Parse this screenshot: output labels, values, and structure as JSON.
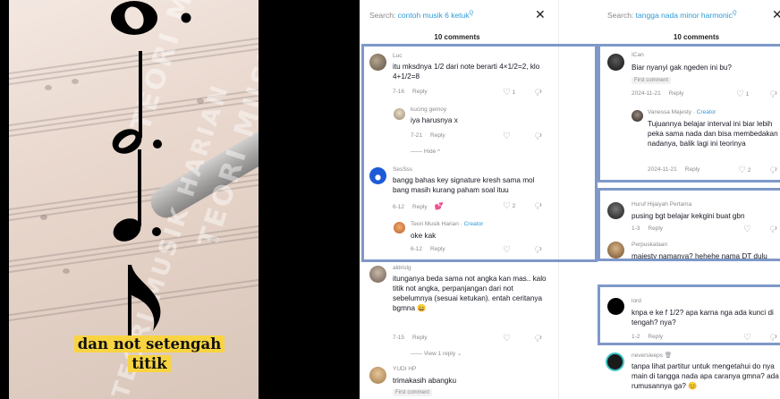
{
  "video": {
    "caption": "dan not setengah titik",
    "watermark_1": "TEORI MUSIK HARIAN",
    "watermark_2": "TEORI MUSIK HARIAN",
    "watermark_3": "TEORI MUSIK HARIAN"
  },
  "panel1": {
    "search_label": "Search:",
    "search_query": "contoh musik 6 ketuk",
    "comment_count": "10 comments",
    "comments": [
      {
        "user": "Luc",
        "text": "itu mksdnya 1/2 dari note berarti 4×1/2=2, klo 4+1/2=8",
        "date": "7-16",
        "reply": "Reply",
        "likes": "1"
      },
      {
        "user": "kucing gemoy",
        "text": "iya harusnya x",
        "date": "7-21",
        "reply": "Reply",
        "likes": ""
      },
      {
        "hide": "Hide"
      },
      {
        "user": "SesSss",
        "text": "bangg bahas key signature kresh sama mol bang masih kurang paham soal ituu",
        "date": "6-12",
        "reply": "Reply",
        "likes": "2"
      },
      {
        "user": "Teori Musik Harian",
        "creator": "Creator",
        "text": "oke kak",
        "date": "6-12",
        "reply": "Reply",
        "likes": ""
      },
      {
        "user": "aldrislg",
        "text": "itunganya beda sama not angka kan mas.. kalo titik not angka, perpanjangan dari not sebelumnya (sesuai ketukan). entah ceritanya bgmna 😄",
        "date": "7-15",
        "reply": "Reply",
        "likes": ""
      },
      {
        "view_replies": "View 1 reply"
      },
      {
        "user": "YUDI HP",
        "text": "trimakasih abangku",
        "badge": "First comment"
      }
    ]
  },
  "panel2": {
    "search_label": "Search:",
    "search_query": "tangga nada minor harmonic",
    "comment_count": "10 comments",
    "comments": [
      {
        "user": "ICan",
        "text": "Biar nyanyi gak ngeden ini bu?",
        "badge": "First comment",
        "date": "2024-11-21",
        "reply": "Reply",
        "likes": "1"
      },
      {
        "user": "Vanessa Majesty",
        "creator": "Creator",
        "text": "Tujuannya belajar interval ini biar lebih peka sama nada dan bisa membedakan nadanya, balik lagi ini teorinya",
        "date": "2024-11-21",
        "reply": "Reply",
        "likes": "2"
      },
      {
        "user": "Huruf Hijaiyah Pertama",
        "text": "pusing bgt belajar kekgini buat gbn",
        "date": "1-3",
        "reply": "Reply",
        "likes": ""
      },
      {
        "user": "Perpuskataan",
        "text": "majesty namanya? hehehe nama DT dulu"
      },
      {
        "user": "lord",
        "text": "knpa e ke f 1/2? apa karna nga ada kunci di tengah? nya?",
        "date": "1-2",
        "reply": "Reply",
        "likes": ""
      },
      {
        "user": "neversleeps",
        "text": "tanpa lihat partitur untuk mengetahui do nya main di tangga nada apa caranya gmna? ada rumusannya ga? 😊"
      }
    ]
  },
  "colors": {
    "highlight": "#7f98c8",
    "link": "#2e9bd6",
    "caption_bg": "#f8d442"
  }
}
